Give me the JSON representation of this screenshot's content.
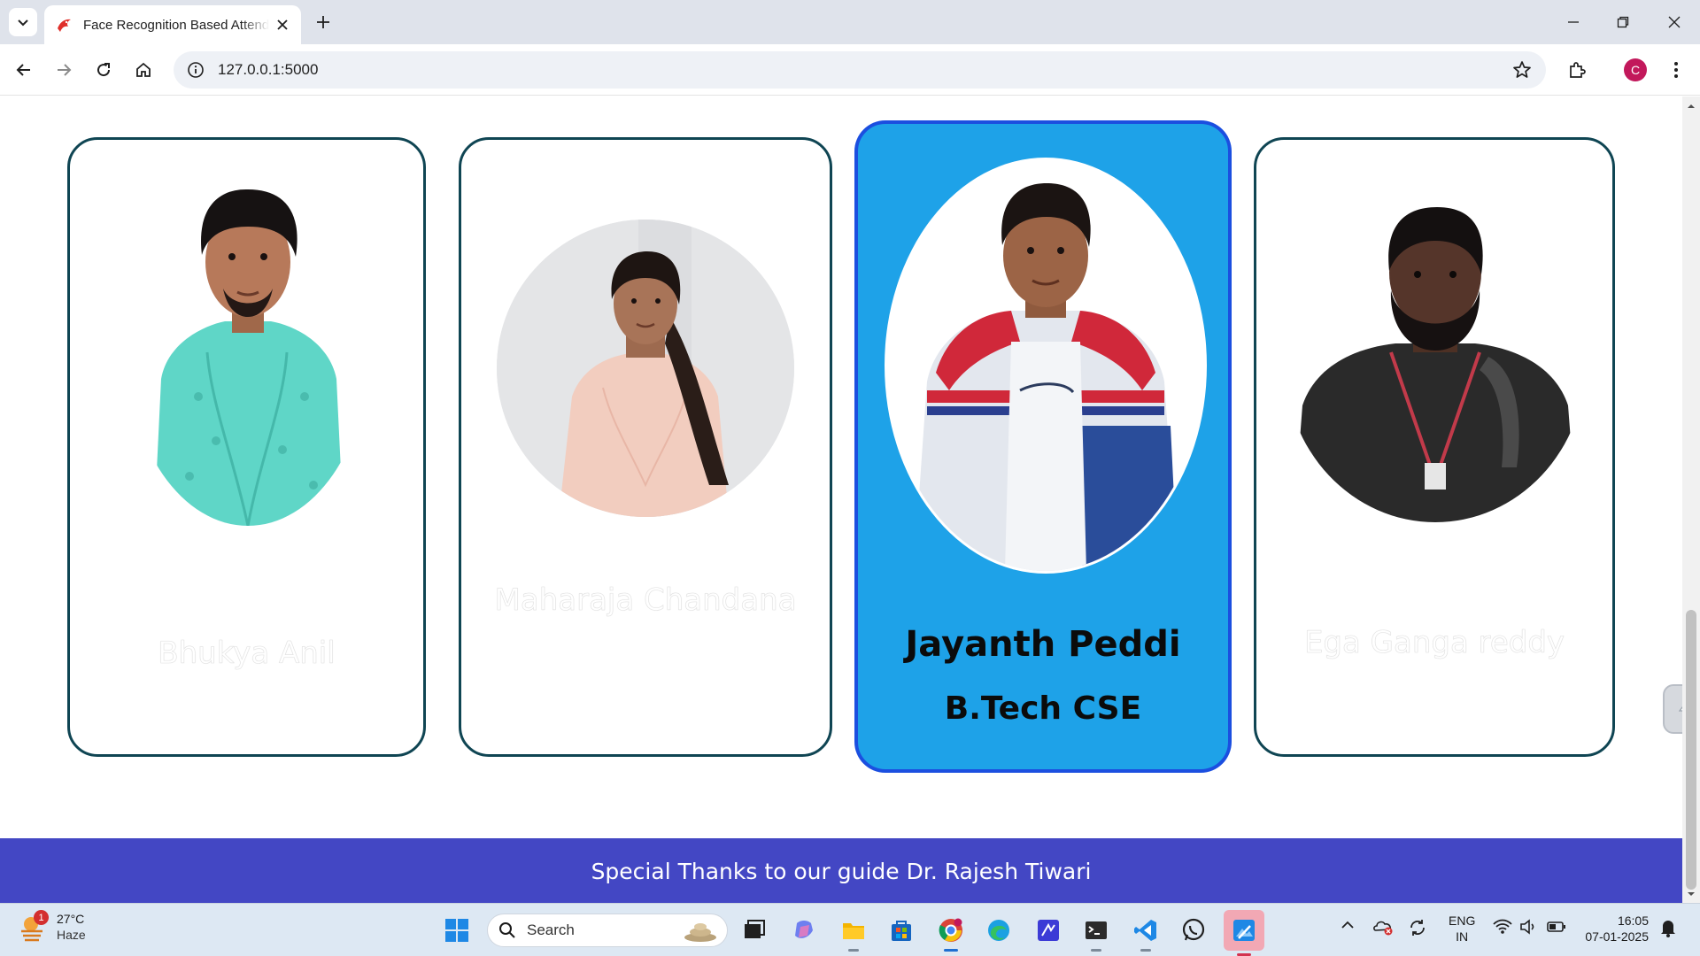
{
  "browser": {
    "tab_title": "Face Recognition Based Attendance",
    "url": "127.0.0.1:5000",
    "profile_initial": "C"
  },
  "team": {
    "members": [
      {
        "name": "Bhukya Anil",
        "role": ""
      },
      {
        "name": "Maharaja Chandana",
        "role": ""
      },
      {
        "name": "Jayanth Peddi",
        "role": "B.Tech CSE"
      },
      {
        "name": "Ega Ganga reddy",
        "role": ""
      }
    ]
  },
  "footer": {
    "text": "Special Thanks to our guide Dr. Rajesh Tiwari"
  },
  "taskbar": {
    "weather_temp": "27°C",
    "weather_condition": "Haze",
    "weather_badge": "1",
    "search_label": "Search",
    "lang_line1": "ENG",
    "lang_line2": "IN",
    "time": "16:05",
    "date": "07-01-2025"
  },
  "colors": {
    "card_border": "#0f4553",
    "active_card_bg": "#1ea2e8",
    "active_card_border": "#1b4fe0",
    "footer_bg": "#4347c4"
  }
}
